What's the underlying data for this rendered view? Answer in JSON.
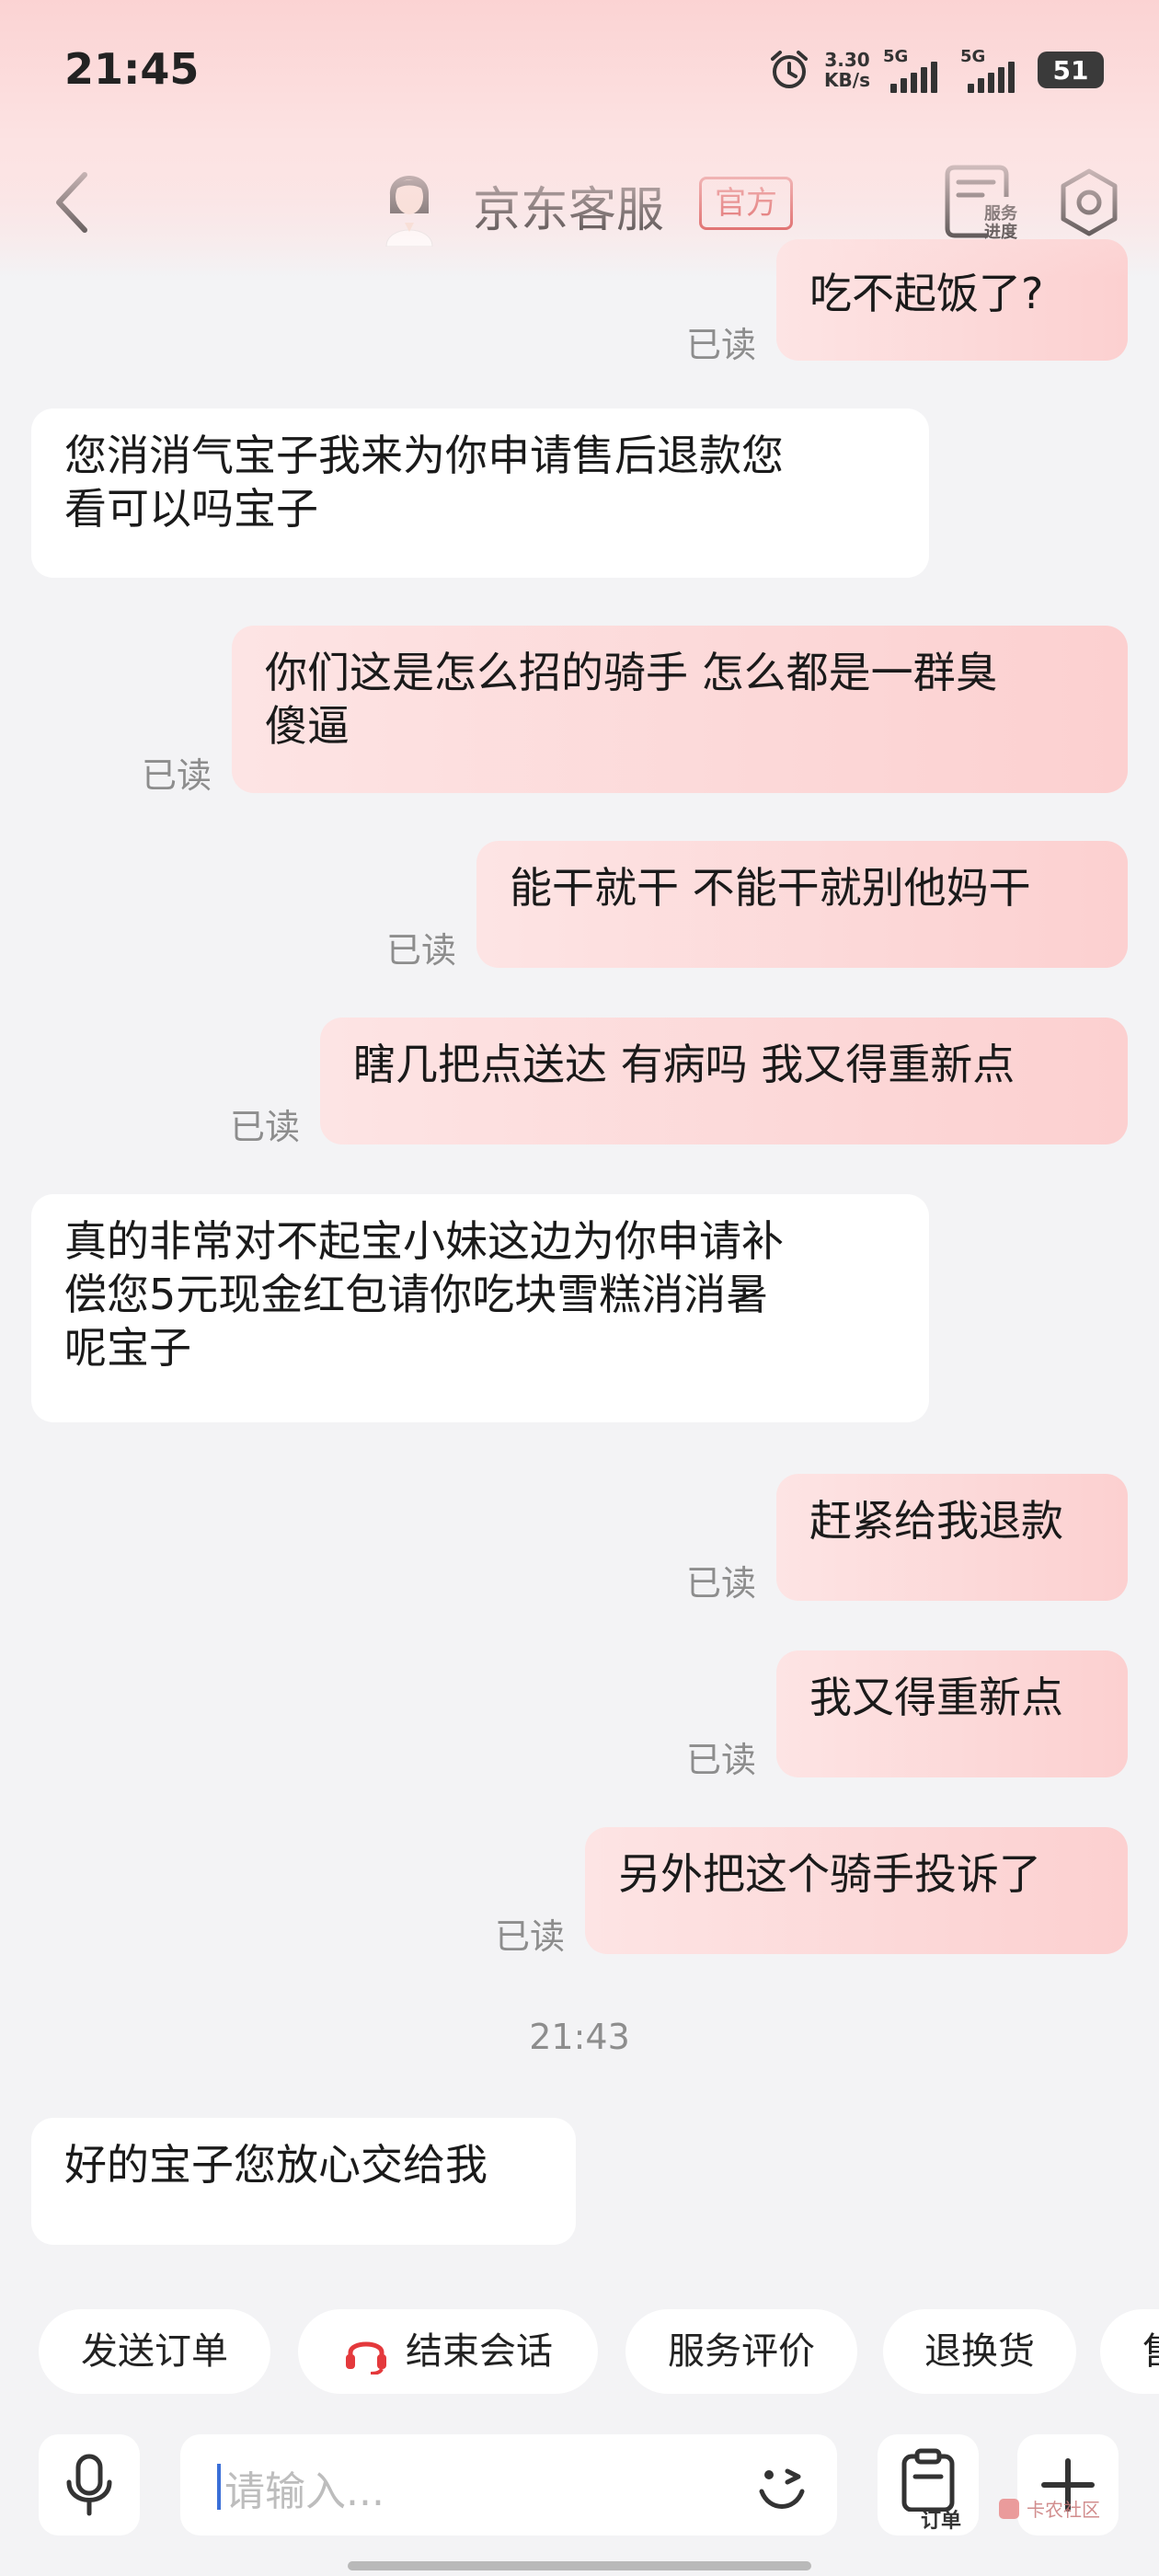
{
  "status_bar": {
    "time": "21:45",
    "net_speed_value": "3.30",
    "net_speed_unit": "KB/s",
    "sim1_label": "5G",
    "sim2_label": "5G",
    "battery": "51"
  },
  "header": {
    "title": "京东客服",
    "badge": "官方",
    "service_progress_line1": "服务",
    "service_progress_line2": "进度"
  },
  "messages": [
    {
      "from": "me",
      "text": "吃不起饭了?",
      "status": "已读"
    },
    {
      "from": "agent",
      "lines": [
        "您消消气宝子我来为你申请售后退款您",
        "看可以吗宝子"
      ]
    },
    {
      "from": "me",
      "lines": [
        "你们这是怎么招的骑手 怎么都是一群臭",
        "傻逼"
      ],
      "status": "已读"
    },
    {
      "from": "me",
      "text": "能干就干 不能干就别他妈干",
      "status": "已读"
    },
    {
      "from": "me",
      "text": "瞎几把点送达 有病吗 我又得重新点",
      "status": "已读"
    },
    {
      "from": "agent",
      "lines": [
        "真的非常对不起宝小妹这边为你申请补",
        "偿您5元现金红包请你吃块雪糕消消暑",
        "呢宝子"
      ]
    },
    {
      "from": "me",
      "text": "赶紧给我退款",
      "status": "已读"
    },
    {
      "from": "me",
      "text": "我又得重新点",
      "status": "已读"
    },
    {
      "from": "me",
      "text": "另外把这个骑手投诉了",
      "status": "已读"
    },
    {
      "from": "agent",
      "text": "好的宝子您放心交给我"
    }
  ],
  "time_separator": "21:43",
  "quick_actions": [
    "发送订单",
    "结束会话",
    "服务评价",
    "退换货",
    "售"
  ],
  "input": {
    "placeholder": "请输入...",
    "order_button": "订单"
  },
  "watermark": "卡农社区",
  "colors": {
    "accent_red": "#d33a3a",
    "my_bubble": "#fcd6d6",
    "agent_bubble": "#ffffff",
    "background": "#f3f3f5"
  }
}
